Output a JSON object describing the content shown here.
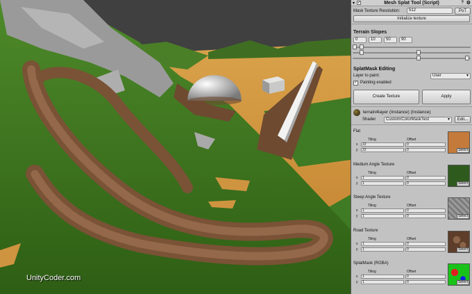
{
  "watermark": "UnityCoder.com",
  "inspector": {
    "script_title": "Mesh Splat Tool (Script)",
    "resolution_label": "Mask Texture Resolution:",
    "resolution_value": "512",
    "pot_button": "PoT",
    "init_button": "Initialize texture",
    "slopes_heading": "Terrain Slopes",
    "slopes": [
      "0",
      "10",
      "50",
      "90"
    ],
    "splat_heading": "SplatMask Editing",
    "layer_label": "Layer to paint:",
    "layer_value": "User",
    "painting_label": "Painting enabled",
    "create_button": "Create Texture",
    "apply_button": "Apply",
    "material_name": "terrain4layer (Instance) (Instance)",
    "shader_label": "Shader",
    "shader_value": "Custom/ColorMaskTest",
    "edit_button": "Edit...",
    "tiling_label": "Tiling",
    "offset_label": "Offset",
    "x_label": "x",
    "y_label": "y",
    "select_label": "Select",
    "textures": [
      {
        "name": "Flat",
        "tiling_x": "22",
        "tiling_y": "22",
        "offset_x": "0",
        "offset_y": "0",
        "color": "#c47a3a"
      },
      {
        "name": "Medium Angle Texture",
        "tiling_x": "1",
        "tiling_y": "1",
        "offset_x": "0",
        "offset_y": "0",
        "color": "#2f5a1e"
      },
      {
        "name": "Steep Angle Texture",
        "tiling_x": "1",
        "tiling_y": "1",
        "offset_x": "0",
        "offset_y": "0",
        "color": "#8d8d8d"
      },
      {
        "name": "Road Texture",
        "tiling_x": "1",
        "tiling_y": "1",
        "offset_x": "0",
        "offset_y": "0",
        "color": "#6e4a34"
      },
      {
        "name": "SplatMask (RGBA)",
        "tiling_x": "1",
        "tiling_y": "1",
        "offset_x": "0",
        "offset_y": "0",
        "color": "#19c219"
      }
    ]
  }
}
